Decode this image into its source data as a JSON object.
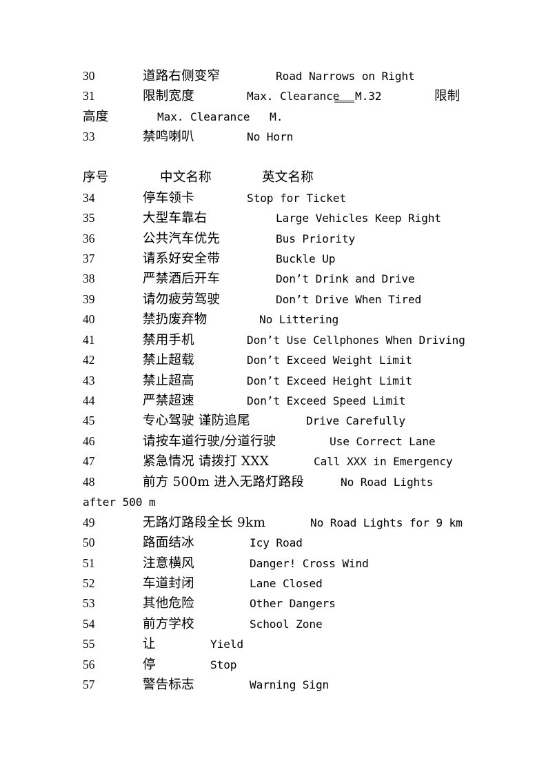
{
  "document": {
    "type": "road-sign-terminology-list",
    "column_headers": {
      "index": "序号",
      "chinese": "中文名称",
      "english": "英文名称"
    },
    "continuation_lines": {
      "row_31_32_wrap": "高度",
      "row_31_32_wrap_en": "Max. Clearance   M.",
      "row_48_wrap": "after 500 m"
    },
    "rows": [
      {
        "num": "30",
        "cn": "道路右侧变窄",
        "en": "Road Narrows on Right"
      },
      {
        "num": "31",
        "cn": "限制宽度",
        "en": "Max. Clearance",
        "en_blank": "___",
        "en_tail": "M.32",
        "trailing_cn": "限制"
      },
      {
        "num": "33",
        "cn": "禁鸣喇叭",
        "en": "No Horn"
      },
      {
        "num": "34",
        "cn": "停车领卡",
        "en": "Stop for Ticket"
      },
      {
        "num": "35",
        "cn": "大型车靠右",
        "en": "Large Vehicles Keep Right"
      },
      {
        "num": "36",
        "cn": "公共汽车优先",
        "en": "Bus Priority"
      },
      {
        "num": "37",
        "cn": "请系好安全带",
        "en": "Buckle Up"
      },
      {
        "num": "38",
        "cn": "严禁酒后开车",
        "en": "Don’t Drink and Drive"
      },
      {
        "num": "39",
        "cn": "请勿疲劳驾驶",
        "en": "Don’t Drive When Tired"
      },
      {
        "num": "40",
        "cn": "禁扔废弃物",
        "en": "No Littering"
      },
      {
        "num": "41",
        "cn": "禁用手机",
        "en": "Don’t Use Cellphones When Driving"
      },
      {
        "num": "42",
        "cn": "禁止超载",
        "en": "Don’t Exceed Weight Limit"
      },
      {
        "num": "43",
        "cn": "禁止超高",
        "en": "Don’t Exceed Height Limit"
      },
      {
        "num": "44",
        "cn": "严禁超速",
        "en": "Don’t Exceed Speed Limit"
      },
      {
        "num": "45",
        "cn": "专心驾驶 谨防追尾",
        "en": "Drive Carefully"
      },
      {
        "num": "46",
        "cn": "请按车道行驶/分道行驶",
        "en": "Use Correct Lane"
      },
      {
        "num": "47",
        "cn": "紧急情况 请拨打 XXX",
        "en": "Call XXX in Emergency"
      },
      {
        "num": "48",
        "cn": "前方 500m 进入无路灯路段",
        "en": "No Road Lights"
      },
      {
        "num": "49",
        "cn": "无路灯路段全长 9km",
        "en": "No Road Lights for 9 km"
      },
      {
        "num": "50",
        "cn": "路面结冰",
        "en": "Icy Road"
      },
      {
        "num": "51",
        "cn": "注意横风",
        "en": "Danger! Cross Wind"
      },
      {
        "num": "52",
        "cn": "车道封闭",
        "en": "Lane Closed"
      },
      {
        "num": "53",
        "cn": "其他危险",
        "en": "Other Dangers"
      },
      {
        "num": "54",
        "cn": "前方学校",
        "en": "School Zone"
      },
      {
        "num": "55",
        "cn": "让",
        "en": "Yield"
      },
      {
        "num": "56",
        "cn": "停",
        "en": "Stop"
      },
      {
        "num": "57",
        "cn": "警告标志",
        "en": "Warning Sign"
      }
    ]
  }
}
